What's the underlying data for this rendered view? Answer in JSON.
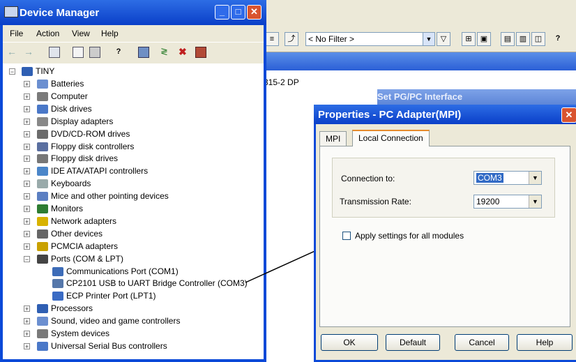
{
  "device_manager": {
    "title": "Device Manager",
    "window_buttons": {
      "minimize": "_",
      "maximize": "□",
      "close": "✕"
    },
    "menu": [
      "File",
      "Action",
      "View",
      "Help"
    ],
    "toolbar_icons": [
      "back-arrow-icon",
      "forward-arrow-icon",
      "console-tree-icon",
      "properties-icon",
      "print-icon",
      "help-icon",
      "scan-hardware-icon",
      "update-driver-icon",
      "uninstall-icon",
      "disable-icon"
    ],
    "tree": {
      "root": "TINY",
      "items": [
        {
          "label": "Batteries",
          "icon": "battery-icon",
          "expander": "+"
        },
        {
          "label": "Computer",
          "icon": "computer-icon",
          "expander": "+"
        },
        {
          "label": "Disk drives",
          "icon": "disk-drive-icon",
          "expander": "+"
        },
        {
          "label": "Display adapters",
          "icon": "display-adapter-icon",
          "expander": "+"
        },
        {
          "label": "DVD/CD-ROM drives",
          "icon": "dvd-icon",
          "expander": "+"
        },
        {
          "label": "Floppy disk controllers",
          "icon": "floppy-controller-icon",
          "expander": "+"
        },
        {
          "label": "Floppy disk drives",
          "icon": "floppy-drive-icon",
          "expander": "+"
        },
        {
          "label": "IDE ATA/ATAPI controllers",
          "icon": "ide-controller-icon",
          "expander": "+"
        },
        {
          "label": "Keyboards",
          "icon": "keyboard-icon",
          "expander": "+"
        },
        {
          "label": "Mice and other pointing devices",
          "icon": "mouse-icon",
          "expander": "+"
        },
        {
          "label": "Monitors",
          "icon": "monitor-icon",
          "expander": "+"
        },
        {
          "label": "Network adapters",
          "icon": "network-adapter-icon",
          "expander": "+"
        },
        {
          "label": "Other devices",
          "icon": "unknown-device-icon",
          "expander": "+"
        },
        {
          "label": "PCMCIA adapters",
          "icon": "pcmcia-icon",
          "expander": "+"
        },
        {
          "label": "Ports (COM & LPT)",
          "icon": "port-icon",
          "expander": "−"
        }
      ],
      "port_children": [
        "Communications Port (COM1)",
        "CP2101 USB to UART Bridge Controller (COM3)",
        "ECP Printer Port (LPT1)"
      ],
      "items_after": [
        {
          "label": "Processors",
          "icon": "processor-icon",
          "expander": "+"
        },
        {
          "label": "Sound, video and game controllers",
          "icon": "sound-icon",
          "expander": "+"
        },
        {
          "label": "System devices",
          "icon": "system-device-icon",
          "expander": "+"
        },
        {
          "label": "Universal Serial Bus controllers",
          "icon": "usb-icon",
          "expander": "+"
        }
      ]
    }
  },
  "background_app": {
    "filter": "< No Filter >",
    "device_label": "315-2 DP",
    "set_pg_title": "Set PG/PC Interface"
  },
  "properties": {
    "title": "Properties - PC Adapter(MPI)",
    "close": "✕",
    "tabs": [
      "MPI",
      "Local Connection"
    ],
    "active_tab": "Local Connection",
    "connection_to_label": "Connection to:",
    "connection_to_value": "COM3",
    "transmission_rate_label": "Transmission Rate:",
    "transmission_rate_value": "19200",
    "apply_label": "Apply settings for all modules",
    "apply_checked": false,
    "buttons": {
      "ok": "OK",
      "default": "Default",
      "cancel": "Cancel",
      "help": "Help"
    }
  },
  "colors": {
    "xp_title_blue": "#0a3fc8",
    "selection": "#316ac5",
    "close_red": "#d9542f",
    "dialog_face": "#ece9d8"
  }
}
